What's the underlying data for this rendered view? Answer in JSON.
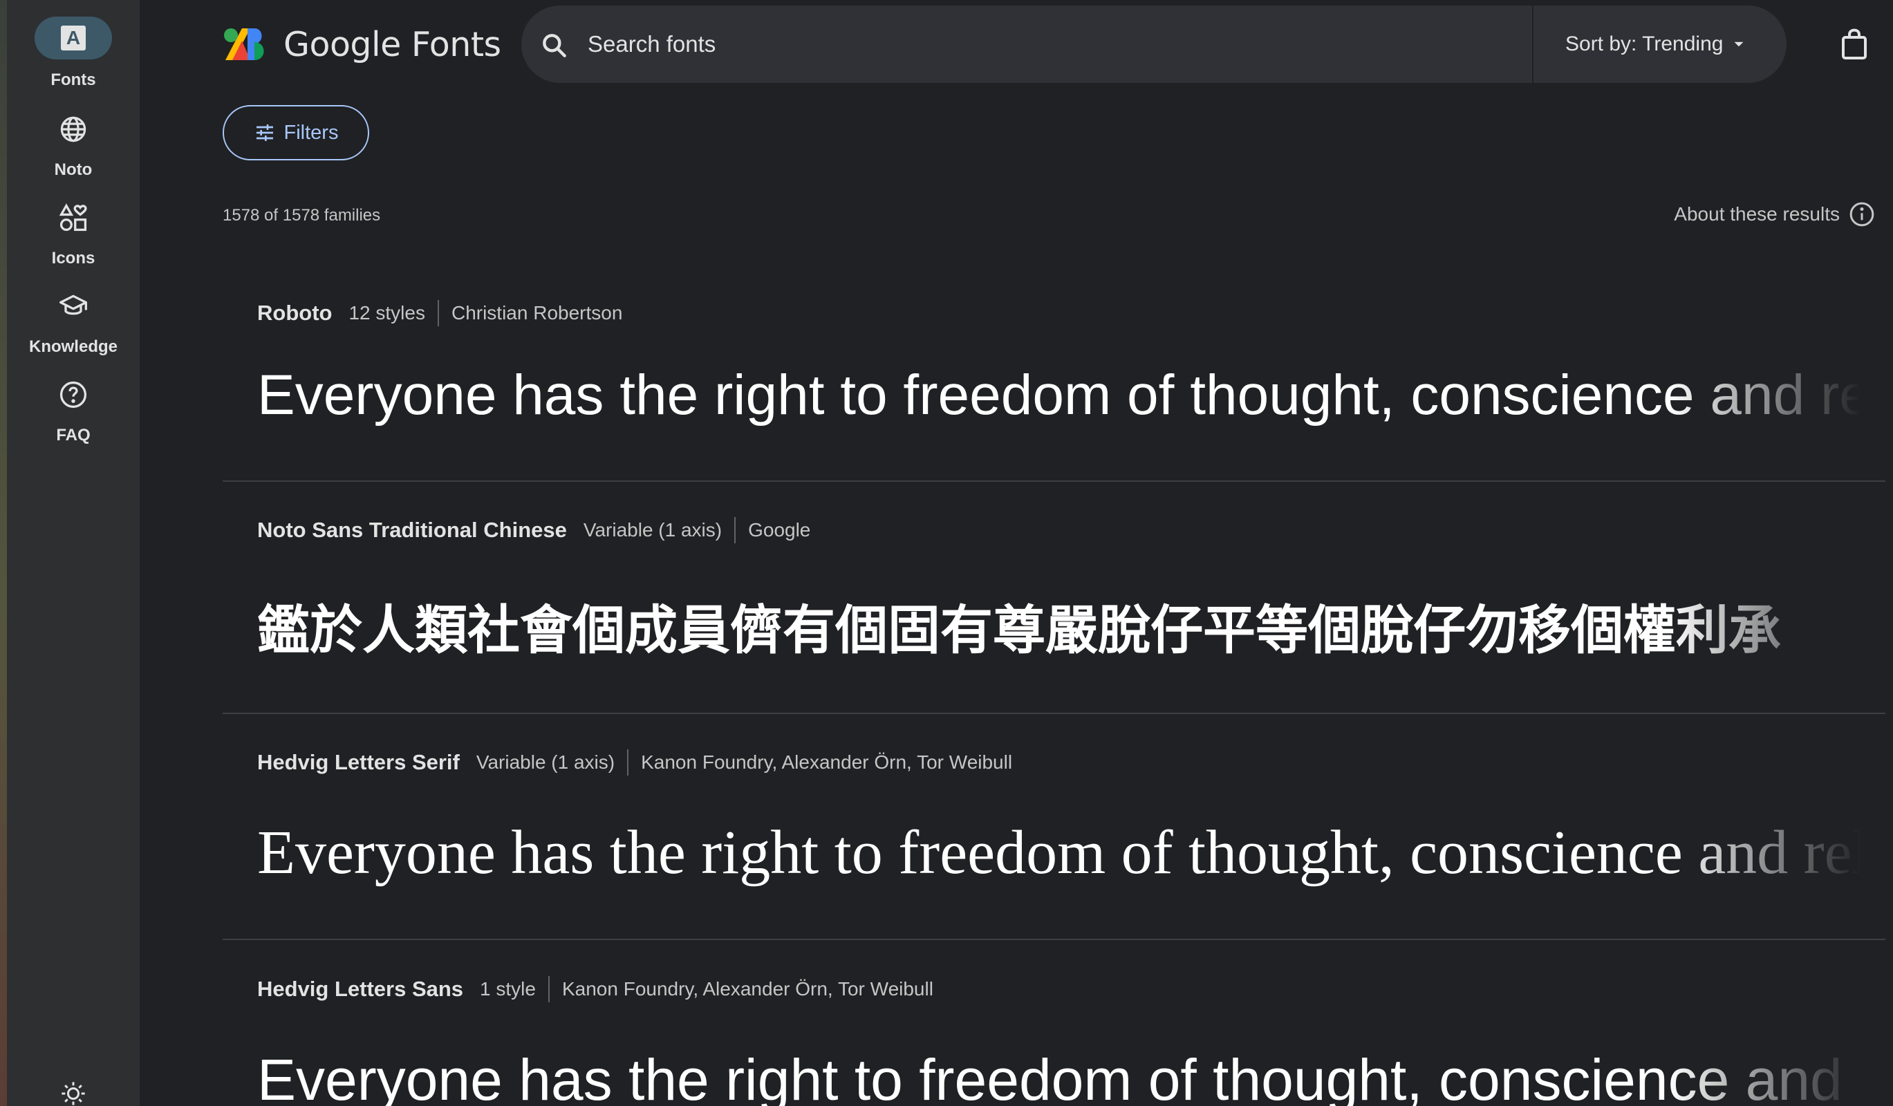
{
  "rail": {
    "items": [
      {
        "label": "Fonts",
        "icon": "font-icon"
      },
      {
        "label": "Noto",
        "icon": "globe-icon"
      },
      {
        "label": "Icons",
        "icon": "shapes-icon"
      },
      {
        "label": "Knowledge",
        "icon": "school-icon"
      },
      {
        "label": "FAQ",
        "icon": "help-icon"
      }
    ],
    "font_icon_glyph": "A",
    "theme_icon": "sun-icon"
  },
  "header": {
    "logo_text": "Google Fonts",
    "search_placeholder": "Search fonts",
    "sort_label": "Sort by: Trending"
  },
  "filters_label": "Filters",
  "results": {
    "count_text": "1578 of 1578 families",
    "about_text": "About these results"
  },
  "fonts": [
    {
      "name": "Roboto",
      "styles": "12 styles",
      "designer": "Christian Robertson",
      "preview": "Everyone has the right to freedom of thought, conscience and religion"
    },
    {
      "name": "Noto Sans Traditional Chinese",
      "styles": "Variable (1 axis)",
      "designer": "Google",
      "preview": "鑑於人類社會個成員儕有個固有尊嚴脫仔平等個脫仔勿移個權利承"
    },
    {
      "name": "Hedvig Letters Serif",
      "styles": "Variable (1 axis)",
      "designer": "Kanon Foundry, Alexander Örn, Tor Weibull",
      "preview": "Everyone has the right to freedom of thought, conscience and religion"
    },
    {
      "name": "Hedvig Letters Sans",
      "styles": "1 style",
      "designer": "Kanon Foundry, Alexander Örn, Tor Weibull",
      "preview": "Everyone has the right to freedom of thought, conscience and religion"
    }
  ],
  "colors": {
    "background": "#202124",
    "rail": "#2d2f31",
    "accent": "#a8c7fa",
    "active_pill": "#3d5968"
  }
}
